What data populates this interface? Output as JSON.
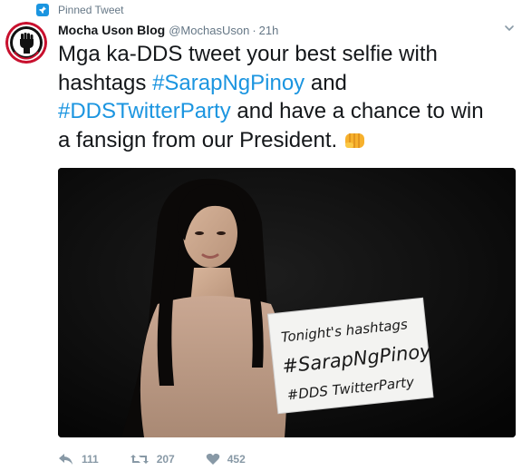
{
  "pinned": {
    "label": "Pinned Tweet",
    "icon": "pin-icon"
  },
  "author": {
    "name": "Mocha Uson Blog",
    "handle": "@MochasUson",
    "separator": "·",
    "time": "21h",
    "avatar_icon": "raised-fist-logo"
  },
  "tweet": {
    "part1": "Mga ka-DDS tweet your best selfie with hashtags ",
    "hashtag1": "#SarapNgPinoy",
    "part2": " and ",
    "hashtag2": "#DDSTwitterParty",
    "part3": " and have a chance to win a fansign from our President.",
    "emoji": "oncoming-fist-emoji"
  },
  "photo": {
    "sign_lines": [
      "Tonight's hashtags",
      "#SarapNgPinoy",
      "#DDS TwitterParty"
    ]
  },
  "actions": {
    "reply_count": "111",
    "retweet_count": "207",
    "like_count": "452"
  },
  "colors": {
    "accent": "#1b95e0",
    "muted": "#657786",
    "icon": "#8899a6",
    "text": "#14171a"
  }
}
